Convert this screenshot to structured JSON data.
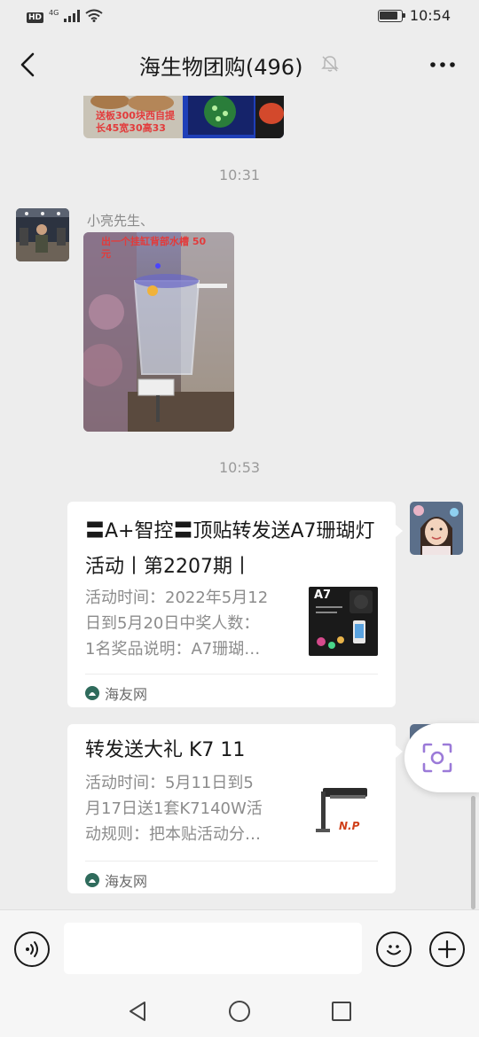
{
  "status_bar": {
    "hd": "HD",
    "network": "4G",
    "time": "10:54",
    "battery_level": 0.85
  },
  "header": {
    "title": "海生物团购(496)"
  },
  "messages": {
    "top_image": {
      "overlay_text_1": "送板300块西自提",
      "overlay_text_2": "长45宽30高33"
    },
    "time_1": "10:31",
    "msg1": {
      "sender": "小亮先生、",
      "overlay_text_1": "出一个挂缸背部水槽 50",
      "overlay_text_2": "元"
    },
    "time_2": "10:53",
    "card1": {
      "title": "〓A+智控〓顶贴转发送A7珊瑚灯活动丨第2207期丨",
      "desc_1": "活动时间：2022年5月12",
      "desc_2": "日到5月20日中奖人数：",
      "desc_3": "1名奖品说明：A7珊瑚…",
      "thumb_label": "A7",
      "source": "海友网"
    },
    "card2": {
      "title": "转发送大礼 K7 11",
      "desc_1": "活动时间：5月11日到5",
      "desc_2": "月17日送1套K7140W活",
      "desc_3": "动规则：把本贴活动分…",
      "thumb_label": "N.P",
      "source": "海友网"
    }
  },
  "input": {
    "placeholder": ""
  },
  "colors": {
    "background": "#ededed",
    "bubble": "#ffffff",
    "time_text": "#9a9a9a",
    "card_desc": "#8c8c8c",
    "float_icon": "#9b7ad8"
  }
}
